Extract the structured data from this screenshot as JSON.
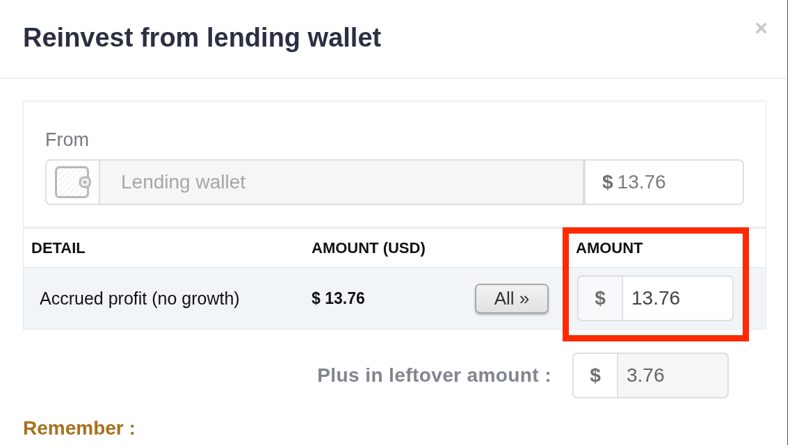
{
  "dialog": {
    "title": "Reinvest from lending wallet",
    "close": "×"
  },
  "from": {
    "label": "From",
    "source": {
      "placeholder": "Lending wallet",
      "disabled": true
    },
    "balance_currency": "$",
    "balance": "13.76"
  },
  "table": {
    "columns": [
      {
        "label": "DETAIL",
        "highlighted": false
      },
      {
        "label": "AMOUNT (USD)",
        "highlighted": false
      },
      {
        "label": "AMOUNT",
        "highlighted": true
      }
    ],
    "rows": [
      {
        "detail": "Accrued profit (no growth)",
        "amount_usd": "$ 13.76",
        "button": "All »",
        "currency": "$",
        "amount": {
          "value": "13.76",
          "disabled": false
        }
      }
    ]
  },
  "leftover": {
    "label": "Plus in leftover amount :",
    "currency": "$",
    "amount": {
      "value": "3.76",
      "disabled": true
    }
  },
  "remember": {
    "heading": "Remember :"
  }
}
